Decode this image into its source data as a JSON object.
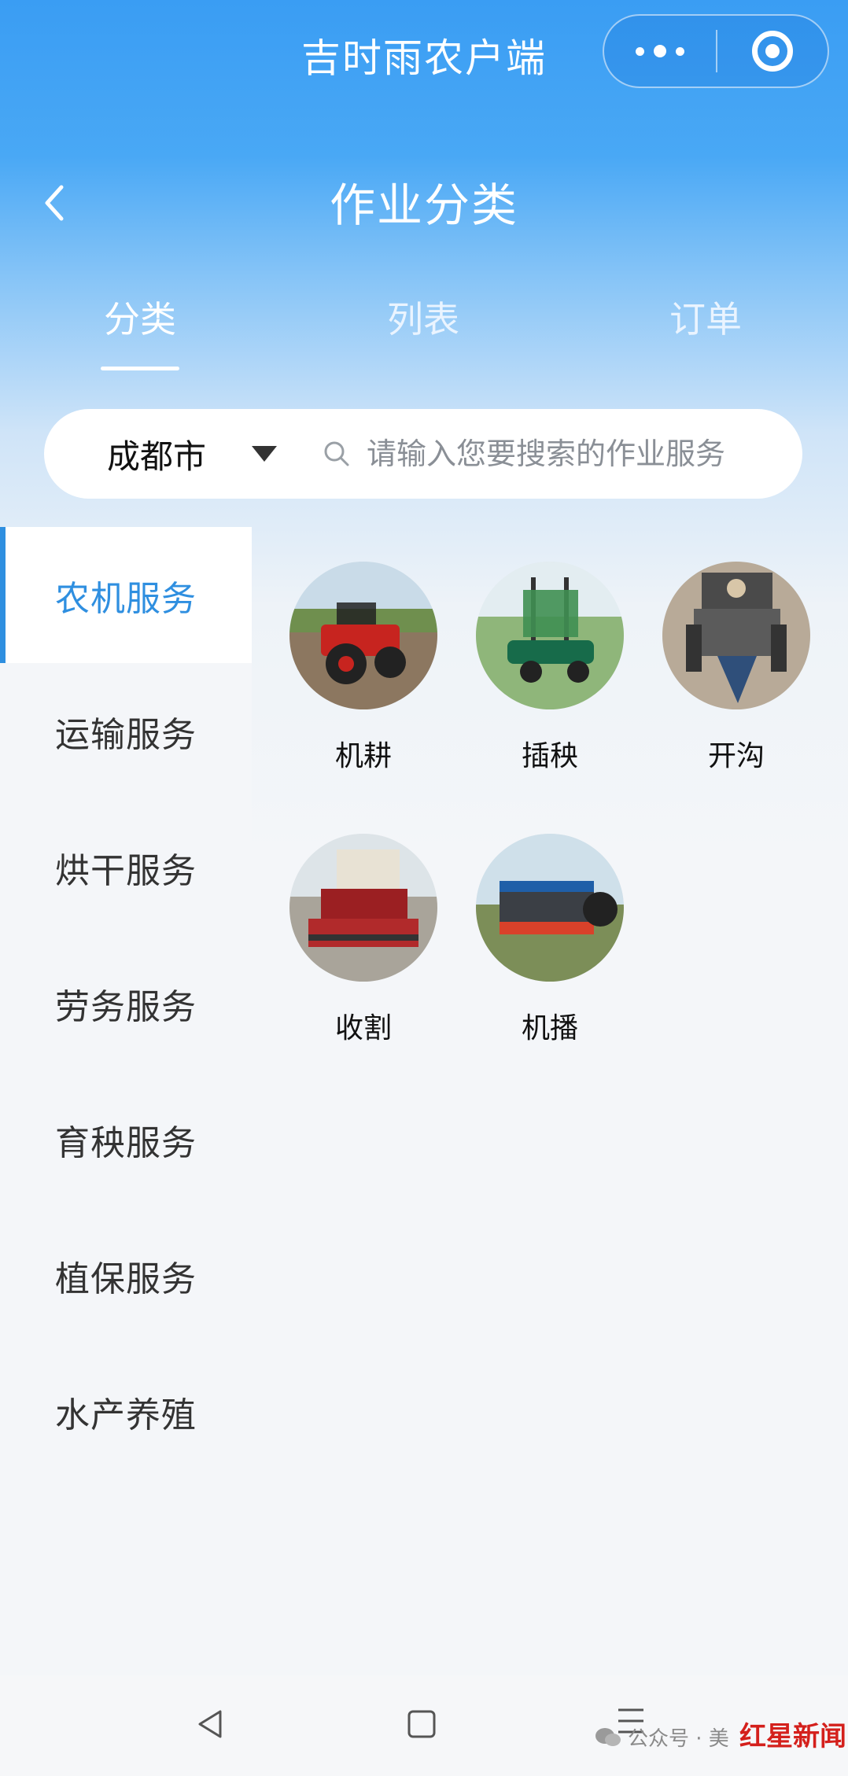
{
  "header": {
    "app_title": "吉时雨农户端",
    "page_title": "作业分类"
  },
  "tabs": [
    {
      "label": "分类",
      "active": true
    },
    {
      "label": "列表",
      "active": false
    },
    {
      "label": "订单",
      "active": false
    }
  ],
  "search": {
    "city": "成都市",
    "placeholder": "请输入您要搜索的作业服务"
  },
  "sidebar": {
    "items": [
      {
        "label": "农机服务",
        "active": true
      },
      {
        "label": "运输服务",
        "active": false
      },
      {
        "label": "烘干服务",
        "active": false
      },
      {
        "label": "劳务服务",
        "active": false
      },
      {
        "label": "育秧服务",
        "active": false
      },
      {
        "label": "植保服务",
        "active": false
      },
      {
        "label": "水产养殖",
        "active": false
      }
    ]
  },
  "categories": [
    {
      "label": "机耕",
      "icon": "tractor-photo"
    },
    {
      "label": "插秧",
      "icon": "rice-transplanter-photo"
    },
    {
      "label": "开沟",
      "icon": "trencher-photo"
    },
    {
      "label": "收割",
      "icon": "harvester-photo"
    },
    {
      "label": "机播",
      "icon": "seeder-photo"
    }
  ],
  "watermark": {
    "text": "公众号 · 美",
    "brand": "红星新闻"
  },
  "colors": {
    "header_blue": "#3a9df3",
    "accent": "#2f8fe0",
    "text_dark": "#111111"
  }
}
